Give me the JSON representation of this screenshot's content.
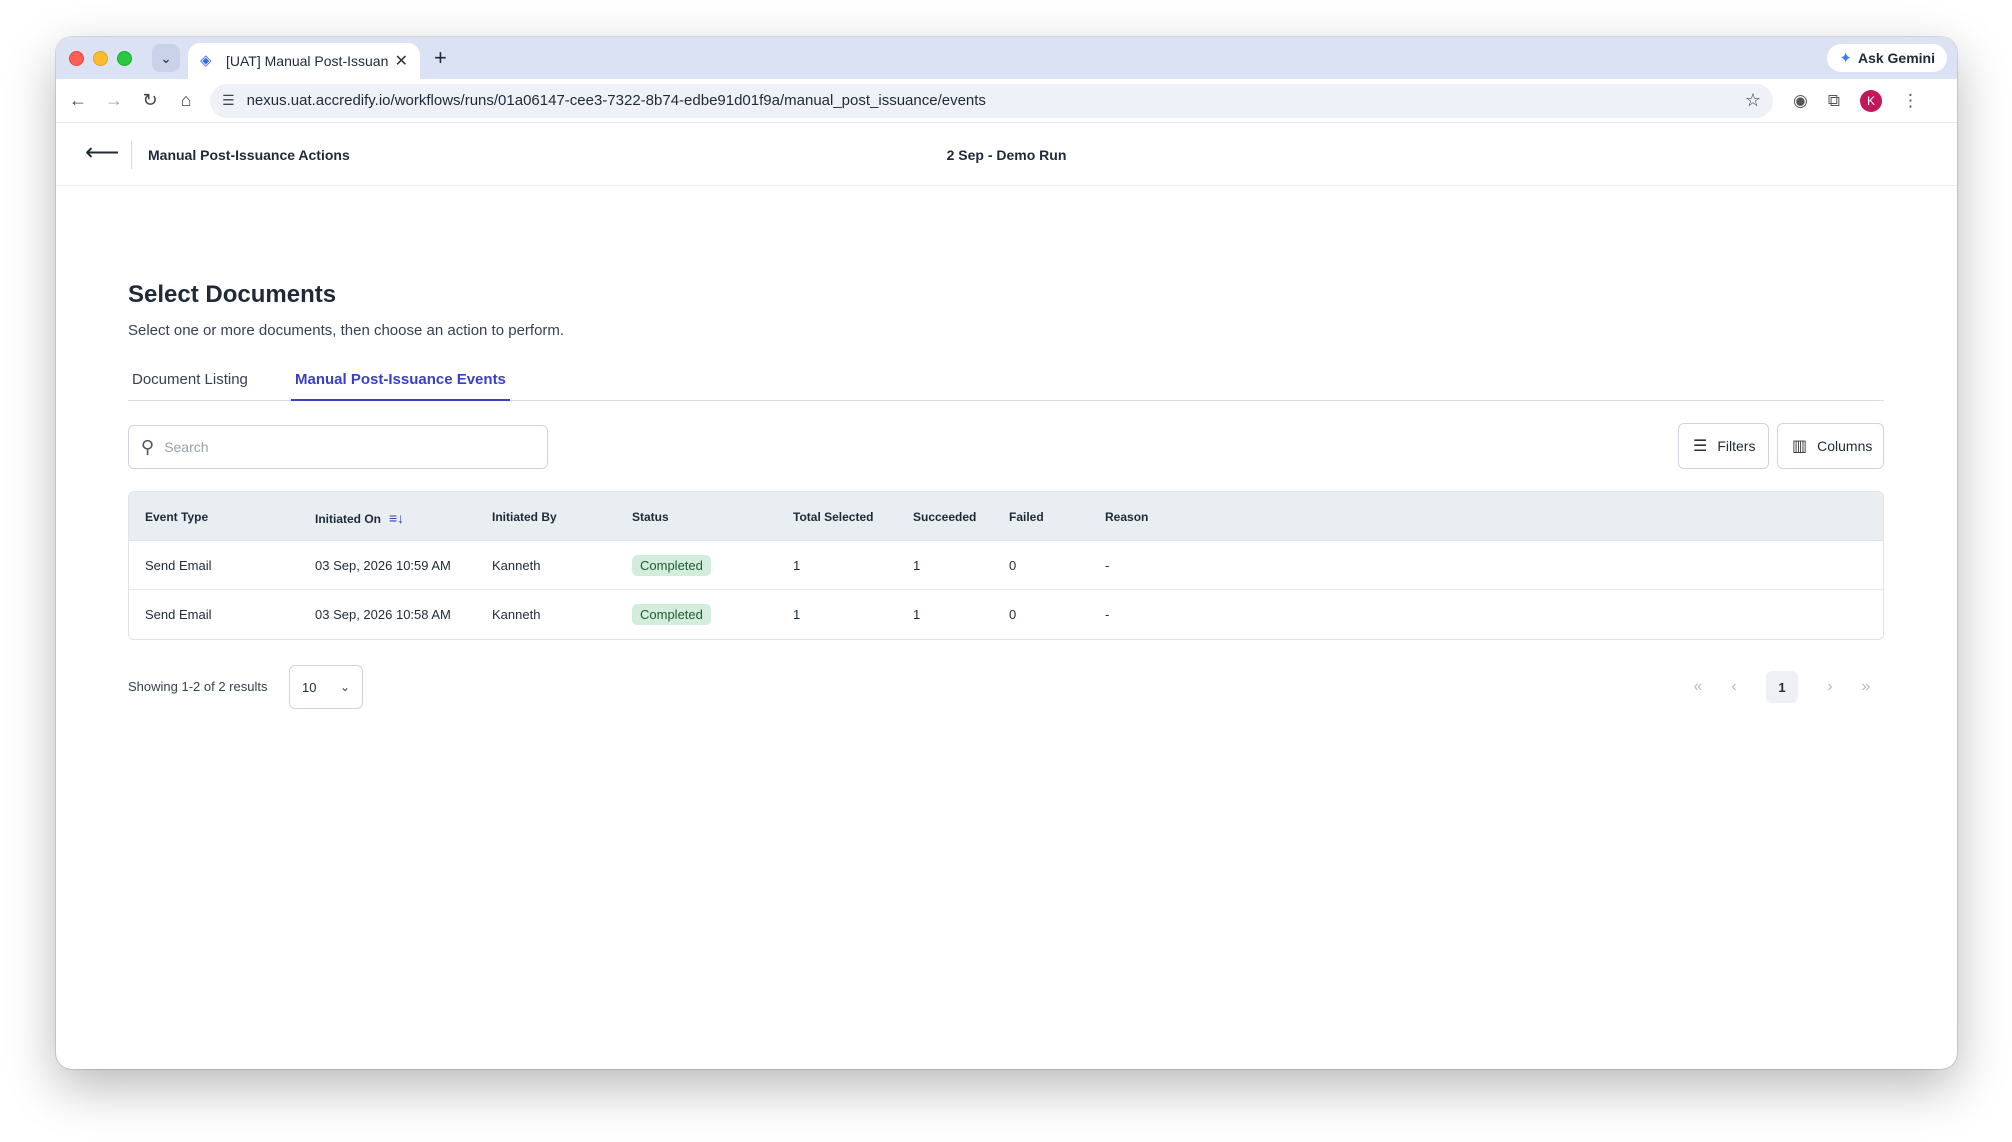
{
  "browser": {
    "tab_title": "[UAT] Manual Post-Issuance Actions",
    "tab_close": "✕",
    "new_tab": "+",
    "gemini_label": "Ask Gemini",
    "url": "nexus.uat.accredify.io/workflows/runs/01a06147-cee3-7322-8b74-edbe91d01f9a/manual_post_issuance/events",
    "profile_initial": "K"
  },
  "header": {
    "back_icon": "arrow-left-icon",
    "title": "Manual Post-Issuance Actions",
    "run_name": "2 Sep - Demo Run"
  },
  "page": {
    "title": "Select Documents",
    "subtitle": "Select one or more documents, then choose an action to perform."
  },
  "tabs": [
    {
      "label": "Document Listing",
      "active": false
    },
    {
      "label": "Manual Post-Issuance Events",
      "active": true
    }
  ],
  "search": {
    "placeholder": "Search",
    "value": ""
  },
  "toolbar": {
    "filters_label": "Filters",
    "columns_label": "Columns"
  },
  "table": {
    "columns": [
      "Event Type",
      "Initiated On",
      "Initiated By",
      "Status",
      "Total Selected",
      "Succeeded",
      "Failed",
      "Reason"
    ],
    "rows": [
      {
        "event_type": "Send Email",
        "initiated_on": "03 Sep, 2026 10:59 AM",
        "initiated_by": "Kanneth",
        "status": "Completed",
        "total_selected": "1",
        "succeeded": "1",
        "failed": "0",
        "reason": "-"
      },
      {
        "event_type": "Send Email",
        "initiated_on": "03 Sep, 2026 10:58 AM",
        "initiated_by": "Kanneth",
        "status": "Completed",
        "total_selected": "1",
        "succeeded": "1",
        "failed": "0",
        "reason": "-"
      }
    ]
  },
  "pagination": {
    "showing": "Showing 1-2 of 2 results",
    "page_size": "10",
    "current_page": "1"
  },
  "colors": {
    "accent": "#3a3fc7",
    "status_completed_bg": "#d3ecdc",
    "status_completed_text": "#1e5c35"
  }
}
